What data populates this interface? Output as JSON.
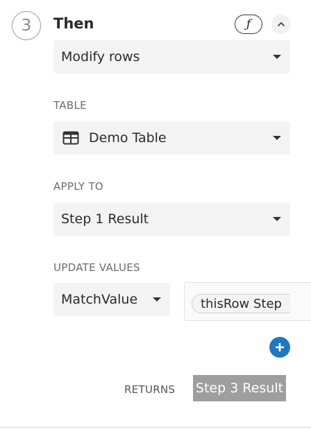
{
  "step": {
    "number": "3",
    "title": "Then",
    "formula_symbol": "ƒ"
  },
  "action": {
    "value": "Modify rows"
  },
  "table": {
    "label": "TABLE",
    "value": "Demo Table",
    "icon": "table-icon"
  },
  "apply_to": {
    "label": "APPLY TO",
    "value": "Step 1 Result"
  },
  "update_values": {
    "label": "UPDATE VALUES",
    "column": "MatchValue",
    "formula_token": "thisRow  Step"
  },
  "returns": {
    "label": "RETURNS",
    "value": "Step 3 Result"
  },
  "colors": {
    "accent": "#1e78c2",
    "returns_badge": "#9e9e9e",
    "field_bg": "#f3f3f3"
  }
}
